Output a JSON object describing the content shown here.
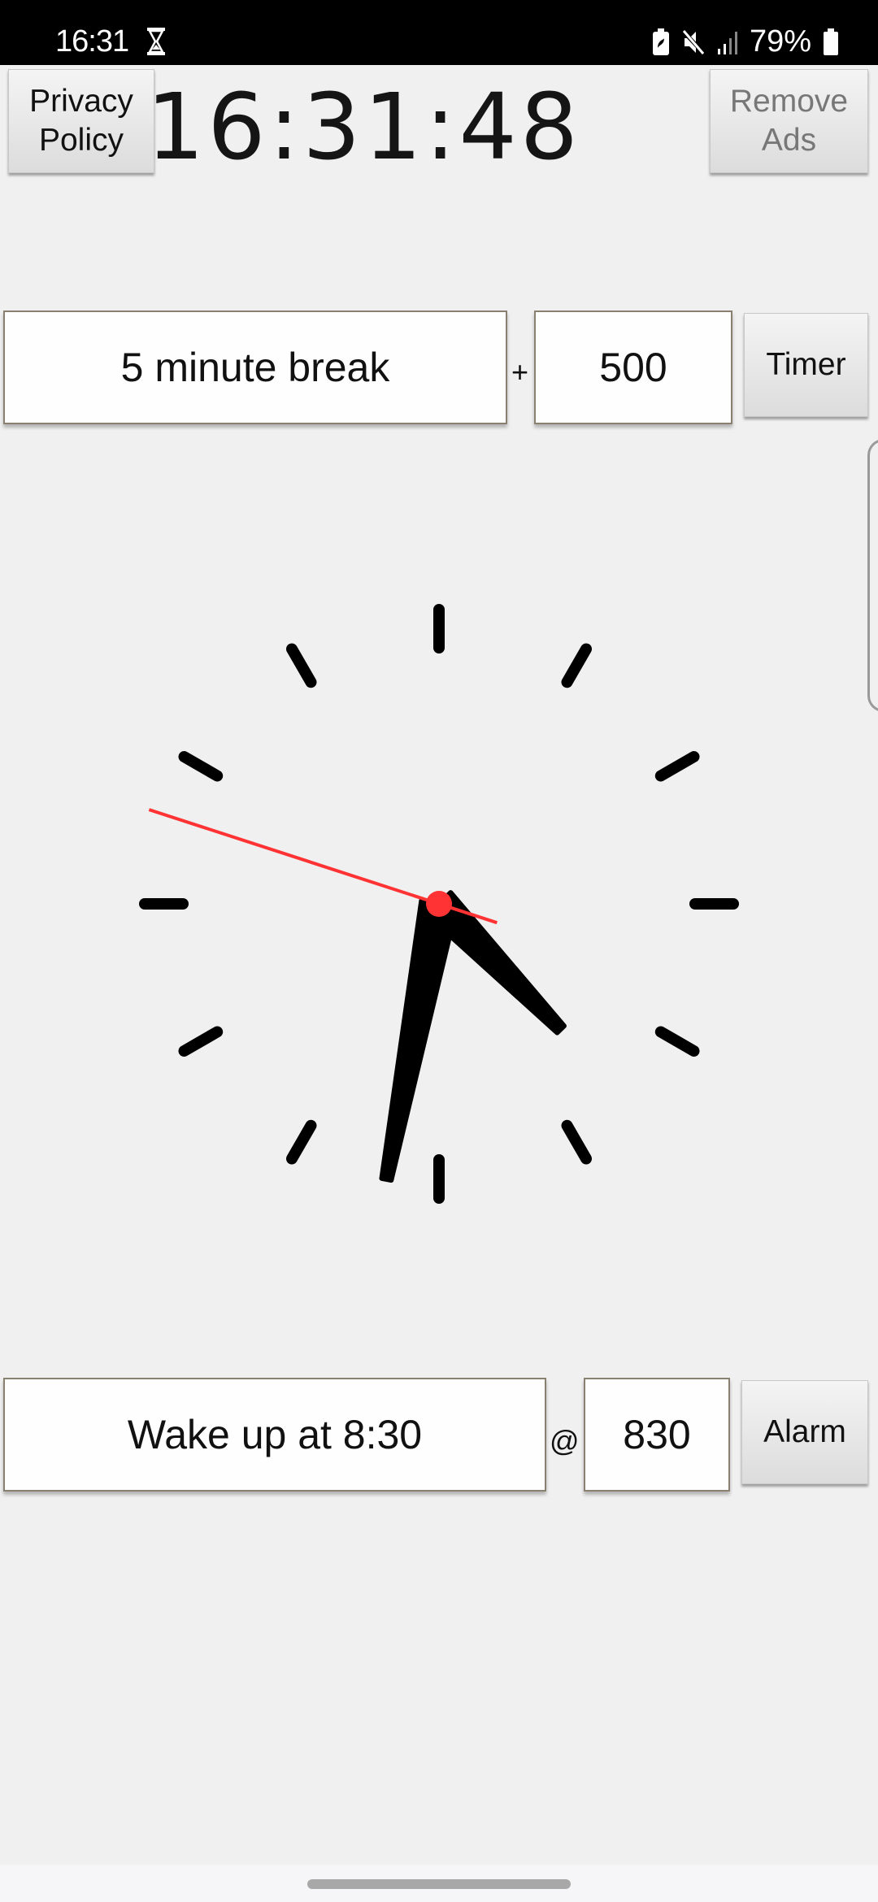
{
  "status_bar": {
    "time": "16:31",
    "left_icons": [
      "hourglass-icon"
    ],
    "right_icons": [
      "battery-saver-icon",
      "mute-icon",
      "signal-icon"
    ],
    "battery_percent": "79%"
  },
  "header": {
    "privacy_label_line1": "Privacy",
    "privacy_label_line2": "Policy",
    "digital_time": "16:31:48",
    "remove_ads_line1": "Remove",
    "remove_ads_line2": "Ads"
  },
  "timer": {
    "label_value": "5 minute break",
    "separator": "+",
    "duration_value": "500",
    "button_label": "Timer"
  },
  "analog_clock": {
    "hours": 16,
    "minutes": 31,
    "seconds": 48,
    "second_hand_color": "#ff3333",
    "hand_color": "#000000"
  },
  "alarm": {
    "label_value": "Wake up at 8:30",
    "separator": "@",
    "time_value": "830",
    "button_label": "Alarm"
  }
}
